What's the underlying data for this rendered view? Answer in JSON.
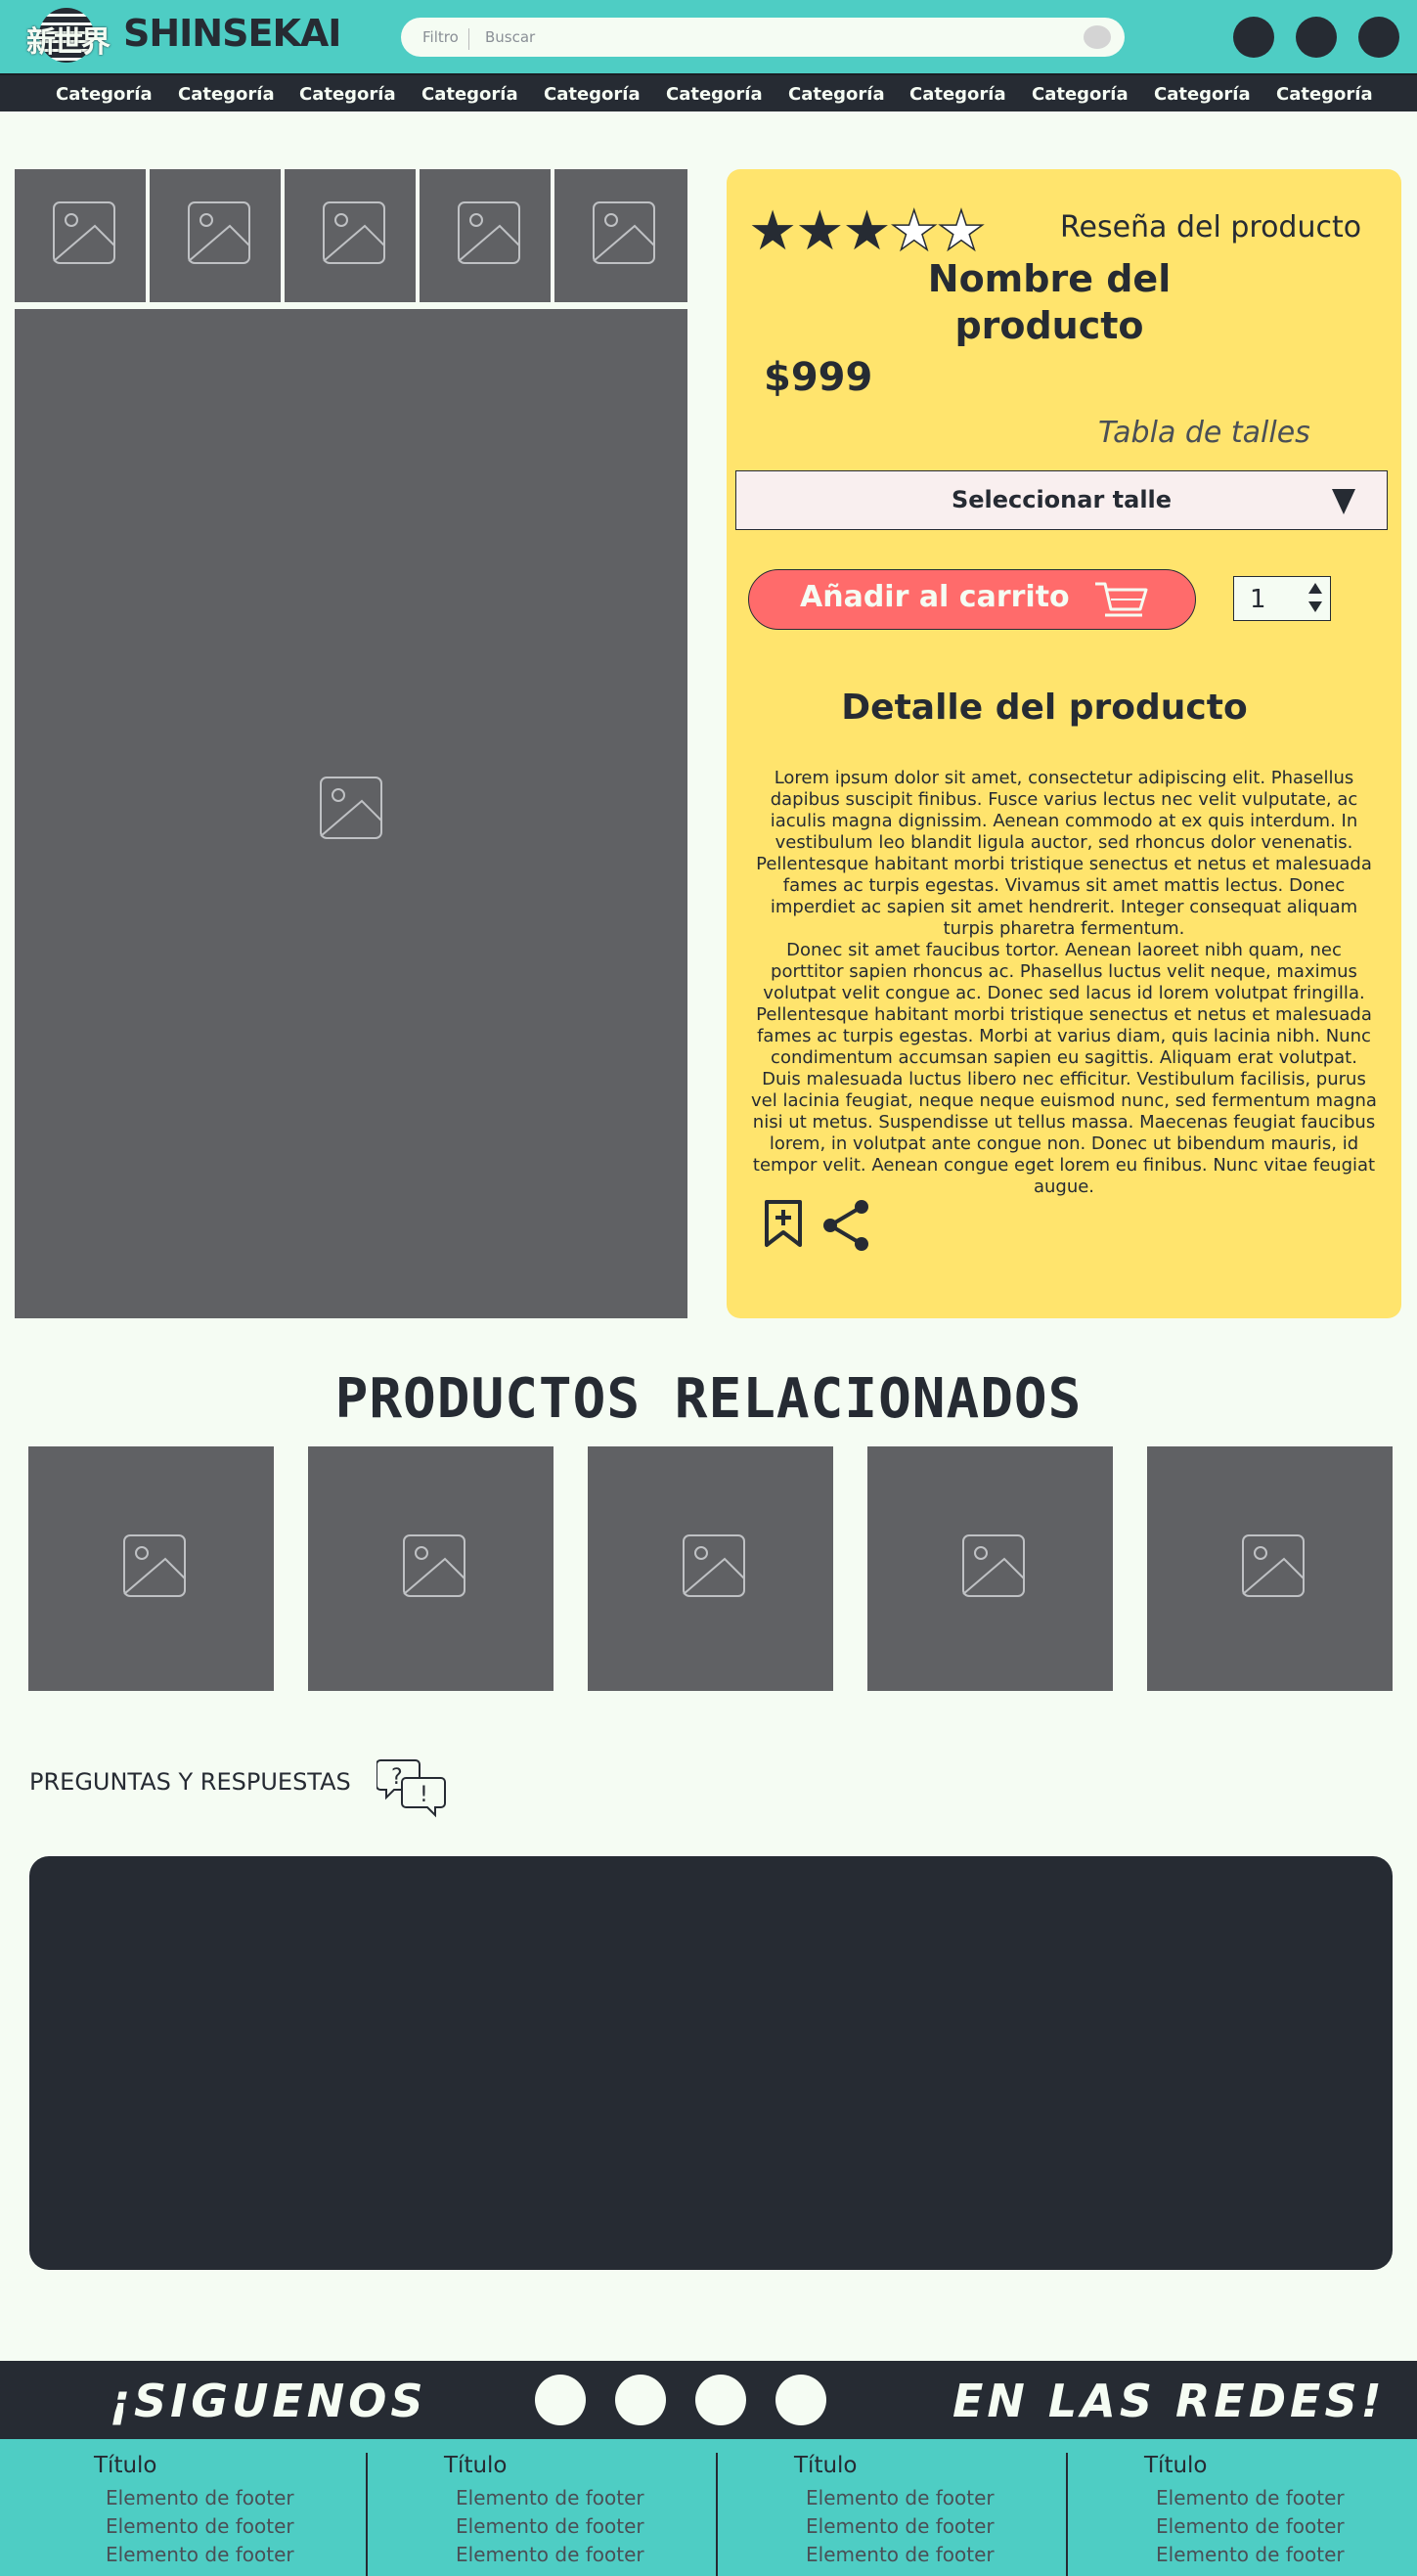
{
  "header": {
    "logo_kanji": "新世界",
    "brand": "SHINSEKAI",
    "search_filter": "Filtro",
    "search_placeholder": "Buscar"
  },
  "nav": {
    "items": [
      "Categoría",
      "Categoría",
      "Categoría",
      "Categoría",
      "Categoría",
      "Categoría",
      "Categoría",
      "Categoría",
      "Categoría",
      "Categoría",
      "Categoría"
    ]
  },
  "product": {
    "rating": 3,
    "rating_max": 5,
    "review_label": "Reseña del producto",
    "name": "Nombre del producto",
    "price": "$999",
    "size_table_label": "Tabla de talles",
    "size_select_label": "Seleccionar talle",
    "add_to_cart_label": "Añadir al carrito",
    "quantity": "1",
    "detail_title": "Detalle del producto",
    "detail_p1": "Lorem ipsum dolor sit amet, consectetur adipiscing elit. Phasellus dapibus suscipit finibus. Fusce varius lectus nec velit vulputate, ac iaculis magna dignissim. Aenean commodo at ex quis interdum. In vestibulum leo blandit ligula auctor, sed rhoncus dolor venenatis. Pellentesque habitant morbi tristique senectus et netus et malesuada fames ac turpis egestas. Vivamus sit amet mattis lectus. Donec imperdiet ac sapien sit amet hendrerit. Integer consequat aliquam turpis pharetra fermentum.",
    "detail_p2": "Donec sit amet faucibus tortor. Aenean laoreet nibh quam, nec porttitor sapien rhoncus ac. Phasellus luctus velit neque, maximus volutpat velit congue ac. Donec sed lacus id lorem volutpat fringilla. Pellentesque habitant morbi tristique senectus et netus et malesuada fames ac turpis egestas. Morbi at varius diam, quis lacinia nibh. Nunc condimentum accumsan sapien eu sagittis. Aliquam erat volutpat. Duis malesuada luctus libero nec efficitur. Vestibulum facilisis, purus vel lacinia feugiat, neque neque euismod nunc, sed fermentum magna nisi ut metus. Suspendisse ut tellus massa. Maecenas feugiat faucibus lorem, in volutpat ante congue non. Donec ut bibendum mauris, id tempor velit. Aenean congue eget lorem eu finibus. Nunc vitae feugiat augue."
  },
  "related": {
    "title": "PRODUCTOS RELACIONADOS"
  },
  "qa": {
    "title": "PREGUNTAS Y RESPUESTAS",
    "icon_glyphs": [
      "?",
      "!"
    ]
  },
  "social": {
    "left_text": "¡SIGUENOS",
    "right_text": "EN LAS REDES!"
  },
  "footer": {
    "columns": [
      {
        "title": "Título",
        "items": [
          "Elemento de footer",
          "Elemento de footer",
          "Elemento de footer"
        ]
      },
      {
        "title": "Título",
        "items": [
          "Elemento de footer",
          "Elemento de footer",
          "Elemento de footer"
        ]
      },
      {
        "title": "Título",
        "items": [
          "Elemento de footer",
          "Elemento de footer",
          "Elemento de footer"
        ]
      },
      {
        "title": "Título",
        "items": [
          "Elemento de footer",
          "Elemento de footer",
          "Elemento de footer"
        ]
      }
    ]
  },
  "colors": {
    "teal": "#4ecdc4",
    "dark": "#262b33",
    "yellow": "#ffe46d",
    "coral": "#ff6b6b",
    "placeholder_gray": "#606164",
    "background": "#f5fcf3"
  },
  "icons": [
    "search-icon",
    "image-placeholder-icon",
    "star-icon",
    "dropdown-arrow-icon",
    "cart-icon",
    "bookmark-add-icon",
    "share-icon",
    "qa-chat-icon",
    "social-icon"
  ]
}
